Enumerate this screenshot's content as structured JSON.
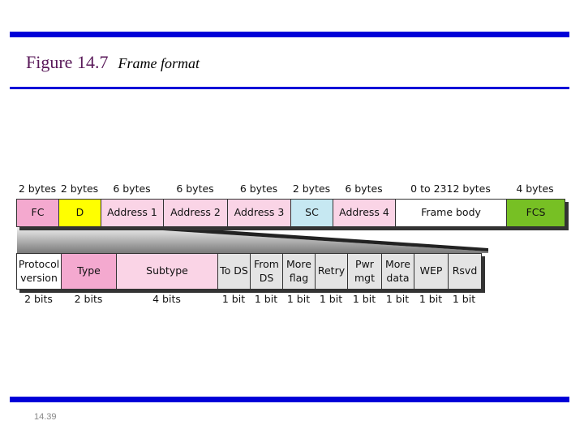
{
  "title": {
    "figure": "Figure 14.7",
    "caption": "Frame format"
  },
  "slide_number": "14.39",
  "frame": {
    "fields": [
      {
        "name": "FC",
        "size": "2 bytes",
        "color": "#f4a9cf"
      },
      {
        "name": "D",
        "size": "2 bytes",
        "color": "#ffff00"
      },
      {
        "name": "Address 1",
        "size": "6 bytes",
        "color": "#fad4e6"
      },
      {
        "name": "Address 2",
        "size": "6 bytes",
        "color": "#fad4e6"
      },
      {
        "name": "Address 3",
        "size": "6 bytes",
        "color": "#fad4e6"
      },
      {
        "name": "SC",
        "size": "2 bytes",
        "color": "#c6e8f2"
      },
      {
        "name": "Address 4",
        "size": "6 bytes",
        "color": "#fad4e6"
      },
      {
        "name": "Frame body",
        "size": "0 to 2312 bytes",
        "color": "#ffffff"
      },
      {
        "name": "FCS",
        "size": "4 bytes",
        "color": "#77c024"
      }
    ]
  },
  "fc": {
    "fields": [
      {
        "name": "Protocol version",
        "size": "2 bits",
        "color": "#ffffff"
      },
      {
        "name": "Type",
        "size": "2 bits",
        "color": "#f4a9cf"
      },
      {
        "name": "Subtype",
        "size": "4 bits",
        "color": "#fad4e6"
      },
      {
        "name": "To DS",
        "size": "1 bit",
        "color": "#e4e4e4"
      },
      {
        "name": "From DS",
        "size": "1 bit",
        "color": "#e4e4e4"
      },
      {
        "name": "More flag",
        "size": "1 bit",
        "color": "#e4e4e4"
      },
      {
        "name": "Retry",
        "size": "1 bit",
        "color": "#e4e4e4"
      },
      {
        "name": "Pwr mgt",
        "size": "1 bit",
        "color": "#e4e4e4"
      },
      {
        "name": "More data",
        "size": "1 bit",
        "color": "#e4e4e4"
      },
      {
        "name": "WEP",
        "size": "1 bit",
        "color": "#e4e4e4"
      },
      {
        "name": "Rsvd",
        "size": "1 bit",
        "color": "#e4e4e4"
      }
    ]
  },
  "colors": {
    "rule": "#0000d8"
  }
}
